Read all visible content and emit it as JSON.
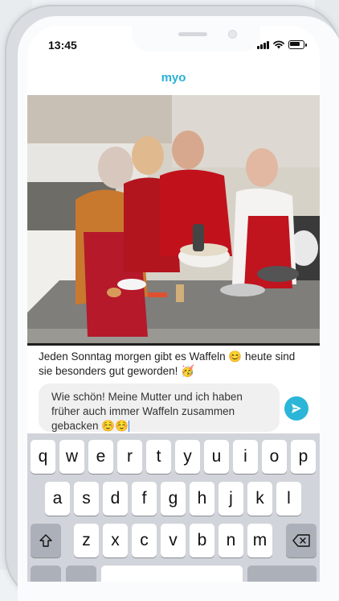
{
  "status": {
    "time": "13:45"
  },
  "app": {
    "title": "myo"
  },
  "post": {
    "caption": "Jeden Sonntag morgen gibt es Waffeln 😊 heute sind sie besonders gut geworden! 🥳"
  },
  "composer": {
    "value": "Wie schön! Meine Mutter und ich haben früher auch immer Waffeln zusammen gebacken ☺️☺️"
  },
  "keyboard": {
    "row1": [
      "q",
      "w",
      "e",
      "r",
      "t",
      "y",
      "u",
      "i",
      "o",
      "p"
    ],
    "row2": [
      "a",
      "s",
      "d",
      "f",
      "g",
      "h",
      "j",
      "k",
      "l"
    ],
    "row3": [
      "z",
      "x",
      "c",
      "v",
      "b",
      "n",
      "m"
    ]
  },
  "colors": {
    "accent": "#29b2d6"
  },
  "icons": [
    "signal-icon",
    "wifi-icon",
    "battery-icon",
    "send-icon",
    "shift-icon",
    "backspace-icon"
  ]
}
